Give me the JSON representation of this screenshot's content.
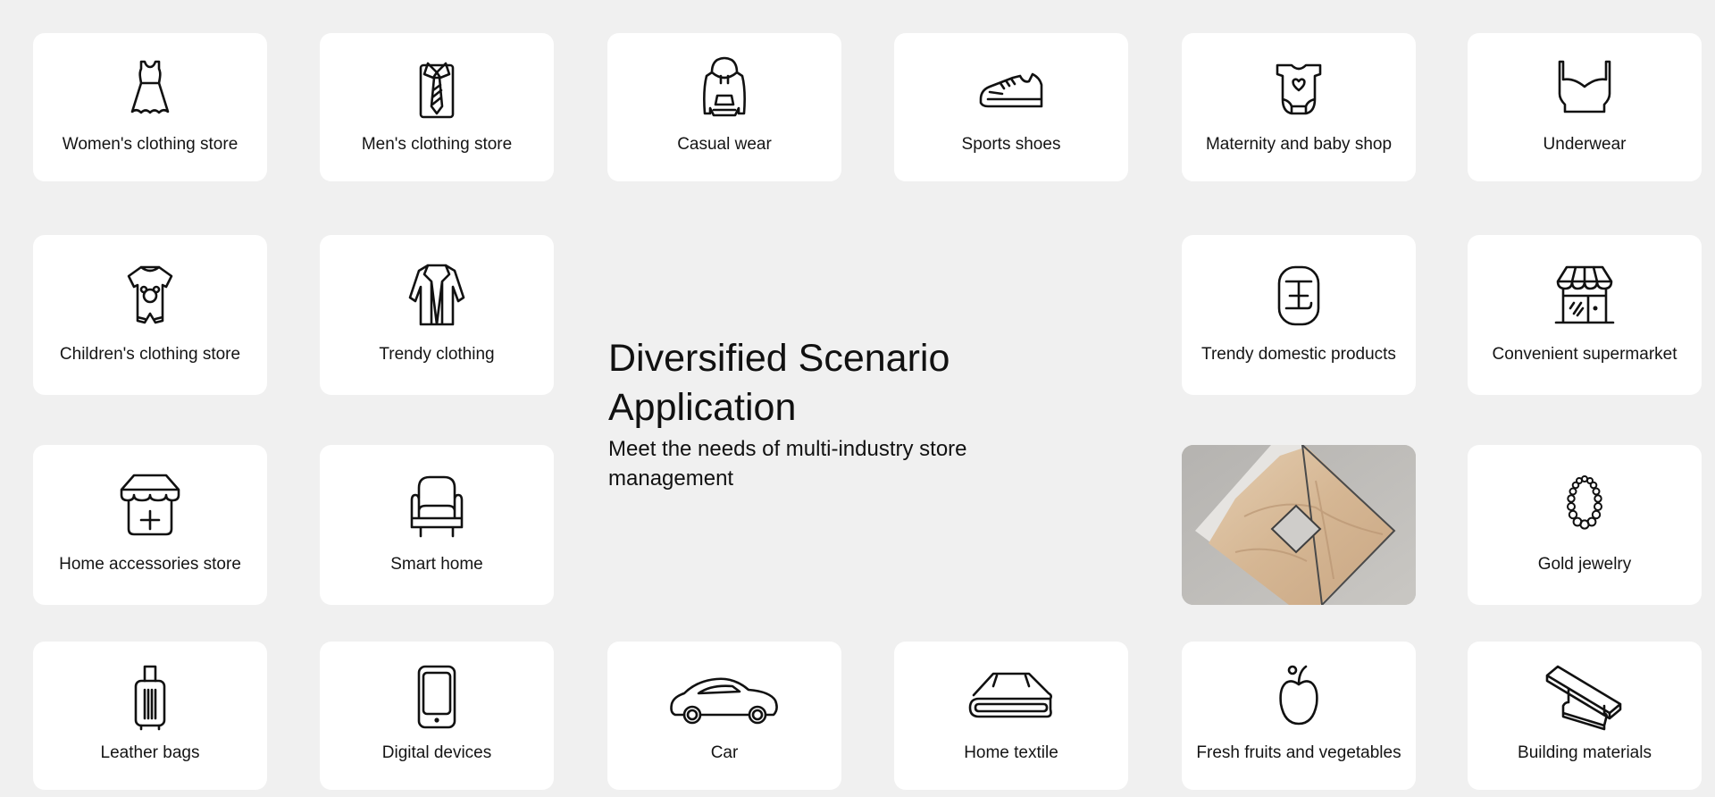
{
  "hero": {
    "title": "Diversified Scenario Application",
    "subtitle": "Meet the needs of multi-industry store management"
  },
  "colors": {
    "background": "#f0f0f0",
    "card": "#ffffff",
    "text": "#141414",
    "photo_fabric": "#d8bd9d",
    "photo_bg": "#b9b7b4"
  },
  "scenarios": [
    {
      "label": "Women's clothing store",
      "icon": "dress-icon"
    },
    {
      "label": "Men's clothing store",
      "icon": "shirt-tie-icon"
    },
    {
      "label": "Casual wear",
      "icon": "hoodie-icon"
    },
    {
      "label": "Sports shoes",
      "icon": "sneaker-icon"
    },
    {
      "label": "Maternity and baby shop",
      "icon": "baby-bodysuit-icon"
    },
    {
      "label": "Underwear",
      "icon": "bra-icon"
    },
    {
      "label": "Children's clothing store",
      "icon": "kids-romper-icon"
    },
    {
      "label": "Trendy clothing",
      "icon": "coat-icon"
    },
    {
      "label": "Trendy domestic products",
      "icon": "guochao-badge-icon"
    },
    {
      "label": "Convenient supermarket",
      "icon": "storefront-icon"
    },
    {
      "label": "Home accessories store",
      "icon": "shop-plus-icon"
    },
    {
      "label": "Smart home",
      "icon": "armchair-icon"
    },
    {
      "label": "Gold jewelry",
      "icon": "necklace-icon"
    },
    {
      "label": "Leather bags",
      "icon": "suitcase-icon"
    },
    {
      "label": "Digital devices",
      "icon": "tablet-icon"
    },
    {
      "label": "Car",
      "icon": "car-icon"
    },
    {
      "label": "Home textile",
      "icon": "folded-blanket-icon"
    },
    {
      "label": "Fresh fruits and vegetables",
      "icon": "apple-icon"
    },
    {
      "label": "Building materials",
      "icon": "steel-beam-icon"
    }
  ],
  "photo": {
    "alt": "Beige fabric folded into a diamond shape"
  }
}
